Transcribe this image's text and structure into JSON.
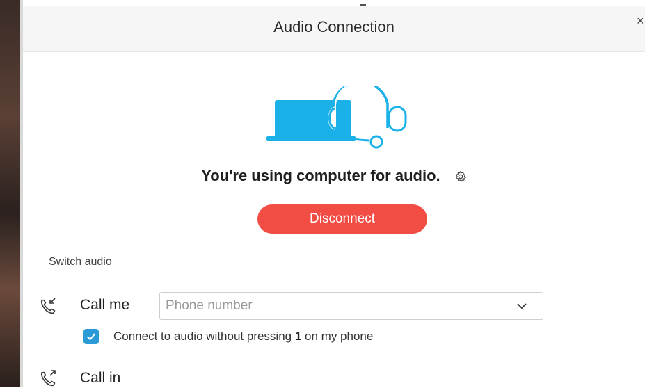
{
  "window": {
    "title": "Audio Connection",
    "close_glyph": "×"
  },
  "status": {
    "message": "You're using computer for audio."
  },
  "buttons": {
    "disconnect": "Disconnect"
  },
  "switch_audio": {
    "label": "Switch audio"
  },
  "call_me": {
    "label": "Call me",
    "phone_placeholder": "Phone number",
    "phone_value": "",
    "checkbox_checked": true,
    "checkbox_text_before": "Connect to audio without pressing ",
    "checkbox_key": "1",
    "checkbox_text_after": " on my phone"
  },
  "call_in": {
    "label": "Call in"
  },
  "colors": {
    "accent_blue": "#1ab0e8",
    "disconnect_red": "#f24d45",
    "checkbox_blue": "#2a9bd6"
  },
  "icons": {
    "illustration": "computer-headset-icon",
    "settings": "gear-icon",
    "call_me": "phone-incoming-icon",
    "call_in": "phone-outgoing-icon",
    "dropdown": "chevron-down-icon",
    "check": "checkmark-icon"
  }
}
